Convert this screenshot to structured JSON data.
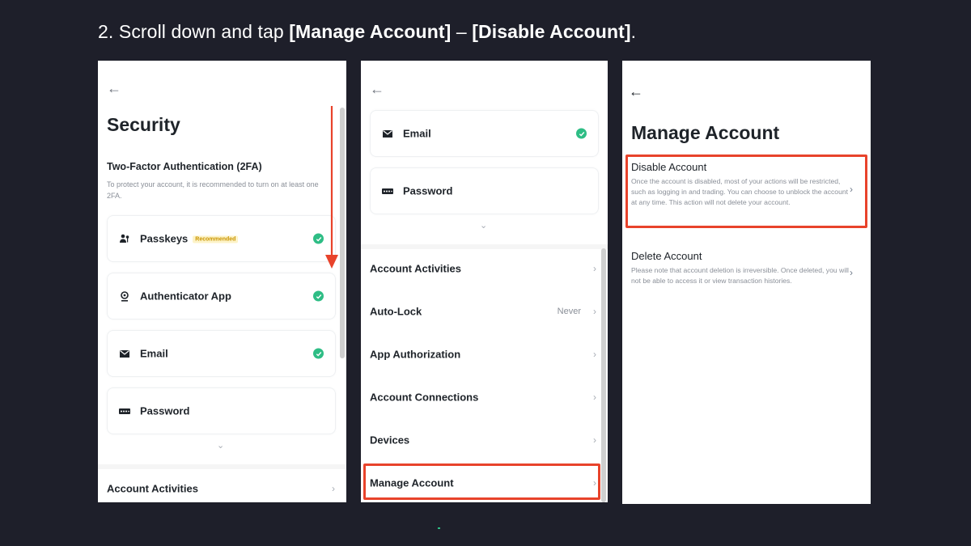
{
  "heading": {
    "prefix": "2. Scroll down and tap ",
    "bold1": "[Manage Account]",
    "sep": " – ",
    "bold2": "[Disable Account]",
    "suffix": "."
  },
  "icons": {
    "back": "back-arrow-icon",
    "check": "check-circle-icon",
    "chevron": "chevron-right-icon"
  },
  "colors": {
    "accent_check": "#2ebd85",
    "highlight": "#e8432b",
    "arrow": "#e8432b",
    "background": "#1e1f2a"
  },
  "panel1": {
    "back": "←",
    "title": "Security",
    "section": "Two-Factor Authentication (2FA)",
    "hint": "To protect your account, it is recommended to turn on at least one 2FA.",
    "cards": [
      {
        "label": "Passkeys",
        "badge": "Recommended"
      },
      {
        "label": "Authenticator App"
      },
      {
        "label": "Email"
      },
      {
        "label": "Password"
      }
    ],
    "expand": "⌄",
    "rows": [
      {
        "label": "Account Activities",
        "chev": "›"
      }
    ]
  },
  "panel2": {
    "back": "←",
    "cards": [
      {
        "label": "Email"
      },
      {
        "label": "Password"
      }
    ],
    "expand": "⌄",
    "rows": [
      {
        "label": "Account Activities",
        "chev": "›"
      },
      {
        "label": "Auto-Lock",
        "value": "Never",
        "chev": "›"
      },
      {
        "label": "App Authorization",
        "chev": "›"
      },
      {
        "label": "Account Connections",
        "chev": "›"
      },
      {
        "label": "Devices",
        "chev": "›"
      },
      {
        "label": "Manage Account",
        "chev": "›"
      }
    ]
  },
  "panel3": {
    "back": "←",
    "title": "Manage Account",
    "items": [
      {
        "title": "Disable Account",
        "desc": "Once the account is disabled, most of your actions will be restricted, such as logging in and trading. You can choose to unblock the account at any time. This action will not delete your account.",
        "chev": "›"
      },
      {
        "title": "Delete Account",
        "desc": "Please note that account deletion is irreversible. Once deleted, you will not be able to access it or view transaction histories.",
        "chev": "›"
      }
    ]
  }
}
